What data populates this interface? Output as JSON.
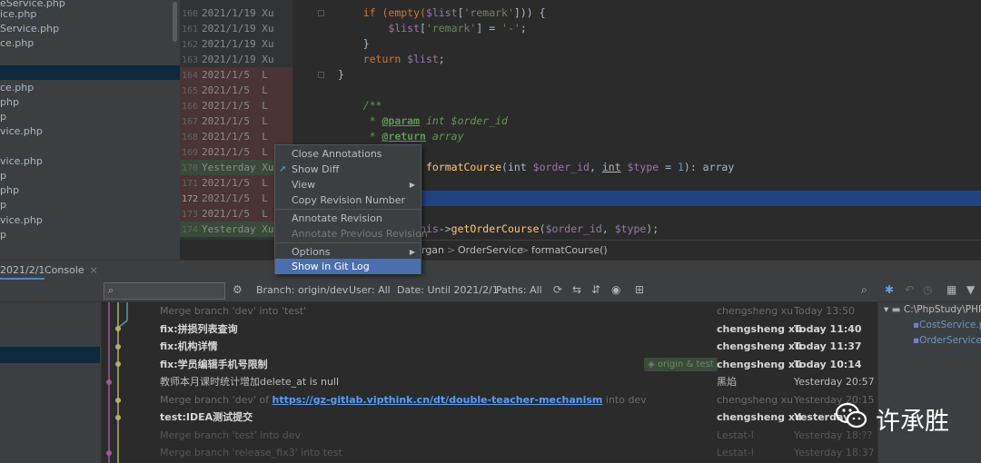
{
  "project_tree": {
    "items": [
      {
        "label": "eService.php"
      },
      {
        "label": "ice.php"
      },
      {
        "label": "Service.php"
      },
      {
        "label": "ce.php"
      },
      {
        "label": ""
      },
      {
        "label": "ce.php"
      },
      {
        "label": "php"
      },
      {
        "label": "p"
      },
      {
        "label": "vice.php"
      },
      {
        "label": ""
      },
      {
        "label": "vice.php"
      },
      {
        "label": "p"
      },
      {
        "label": "php"
      },
      {
        "label": "p"
      },
      {
        "label": "vice.php"
      },
      {
        "label": "p"
      }
    ]
  },
  "annotations": [
    {
      "line": "160",
      "info": "2021/1/19 Xu"
    },
    {
      "line": "161",
      "info": "2021/1/19 Xu"
    },
    {
      "line": "162",
      "info": "2021/1/19 Xu"
    },
    {
      "line": "163",
      "info": "2021/1/19 Xu"
    },
    {
      "line": "164",
      "info": "2021/1/5  L"
    },
    {
      "line": "165",
      "info": "2021/1/5  L"
    },
    {
      "line": "166",
      "info": "2021/1/5  L"
    },
    {
      "line": "167",
      "info": "2021/1/5  L"
    },
    {
      "line": "168",
      "info": "2021/1/5  L"
    },
    {
      "line": "169",
      "info": "2021/1/5  L"
    },
    {
      "line": "170",
      "info": "Yesterday Xu"
    },
    {
      "line": "171",
      "info": "2021/1/5  L"
    },
    {
      "line": "172",
      "info": "2021/1/5  L"
    },
    {
      "line": "173",
      "info": "2021/1/5  L"
    },
    {
      "line": "174",
      "info": "Yesterday Xu"
    }
  ],
  "code": {
    "l160a": "if (empty(",
    "l160b": "$list",
    "l160c": "[",
    "l160d": "'remark'",
    "l160e": "])) {",
    "l161a": "$list",
    "l161b": "[",
    "l161c": "'remark'",
    "l161d": "] = ",
    "l161e": "'-'",
    "l161f": ";",
    "l162": "}",
    "l163a": "return ",
    "l163b": "$list",
    "l163c": ";",
    "l164": "}",
    "l166": "/**",
    "l167a": " * ",
    "l167b": "@param",
    "l167c": " int ",
    "l167d": "$order_id",
    "l168a": " * ",
    "l168b": "@return",
    "l168c": " array",
    "l170a": "ion ",
    "l170b": "formatCourse",
    "l170c": "(int ",
    "l170d": "$order_id",
    "l170e": ", ",
    "l170f": "int",
    "l170g": " $type",
    "l170h": " = ",
    "l170i": "1",
    "l170j": "): array",
    "l172": ");",
    "l174a": "= ",
    "l174b": "$this",
    "l174c": "->",
    "l174d": "getOrderCourse",
    "l174e": "(",
    "l174f": "$order_id",
    "l174g": ", ",
    "l174h": "$type",
    "l174i": ");"
  },
  "breadcrumb": {
    "items": [
      "rgan",
      "OrderService",
      "formatCourse()"
    ],
    "separator": ">"
  },
  "context_menu": {
    "items": [
      {
        "label": "Close Annotations",
        "disabled": false
      },
      {
        "label": "Show Diff",
        "disabled": false,
        "icon": "diff-arrow-icon"
      },
      {
        "label": "View",
        "disabled": false,
        "submenu": true
      },
      {
        "label": "Copy Revision Number",
        "disabled": false
      },
      {
        "label": "Annotate Revision",
        "disabled": false
      },
      {
        "label": "Annotate Previous Revision",
        "disabled": true
      },
      {
        "label": "Options",
        "disabled": false,
        "submenu": true
      },
      {
        "label": "Show in Git Log",
        "disabled": false,
        "active": true
      }
    ]
  },
  "tool_tabs": {
    "vcs_tab": "2021/2/1",
    "console_tab": "Console",
    "close_glyph": "×"
  },
  "log_toolbar": {
    "search_placeholder": "",
    "branch_filter": "Branch: origin/dev",
    "user_filter": "User: All",
    "date_filter": "Date: Until 2021/2/1",
    "paths_filter": "Paths: All"
  },
  "commits": [
    {
      "message": "Merge branch 'dev' into 'test'",
      "author": "chengsheng xu",
      "date": "Today 13:50",
      "style": "dim"
    },
    {
      "message": "fix:拼损列表查询",
      "author": "chengsheng xu",
      "date": "Today 11:40",
      "style": "bold"
    },
    {
      "message": "fix:机构详情",
      "author": "chengsheng xu",
      "date": "Today 11:37",
      "style": "bold"
    },
    {
      "message": "fix:学员编辑手机号限制",
      "author": "chengsheng xu",
      "date": "Today 10:14",
      "style": "bold",
      "tag": "origin & test"
    },
    {
      "message": "教师本月课时统计增加delete_at is null",
      "author": "黑焰",
      "date": "Yesterday 20:57",
      "style": "normal"
    },
    {
      "message": "Merge branch 'dev' of ",
      "link": "https://gz-gitlab.vipthink.cn/dt/double-teacher-mechanism",
      "suffix": " into dev",
      "author": "chengsheng xu",
      "date": "Yesterday 20:15",
      "style": "dim"
    },
    {
      "message": "test:IDEA测试提交",
      "author": "chengsheng xu",
      "date": "Yesterday",
      "style": "bold"
    },
    {
      "message": "Merge branch 'test' into dev",
      "author": "Lestat-l",
      "date": "Yesterday 18:??",
      "style": "dimmer"
    },
    {
      "message": "Merge branch 'release_fix3' into test",
      "author": "Lestat-l",
      "date": "Yesterday 18:37",
      "style": "dimmer"
    }
  ],
  "changes_panel": {
    "root": "C:\\PhpStudy\\PHP",
    "files": [
      "CostService.p",
      "OrderService"
    ]
  },
  "watermark": {
    "text": "许承胜"
  },
  "colors": {
    "accent": "#4b6eaf",
    "selection": "#214283",
    "link": "#589df6"
  }
}
